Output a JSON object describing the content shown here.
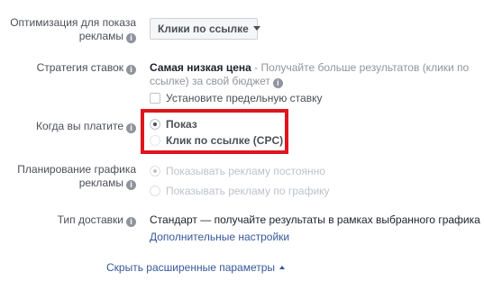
{
  "optimization": {
    "label_line1": "Оптимизация для показа",
    "label_line2": "рекламы",
    "value": "Клики по ссылке"
  },
  "bid_strategy": {
    "label": "Стратегия ставок",
    "value_bold": "Самая низкая цена",
    "desc_line1": " - Получайте больше результатов (клики по",
    "desc_line2": "ссылке) за свой бюджет",
    "cap_checkbox_label": "Установите предельную ставку"
  },
  "payment": {
    "label": "Когда вы платите",
    "options": [
      {
        "label": "Показ",
        "selected": true
      },
      {
        "label": "Клик по ссылке (CPC)",
        "selected": false
      }
    ],
    "highlight_color": "#e0141e"
  },
  "scheduling": {
    "label_line1": "Планирование графика",
    "label_line2": "рекламы",
    "options": [
      {
        "label": "Показывать рекламу постоянно",
        "selected": true,
        "disabled": true
      },
      {
        "label": "Показывать рекламу по графику",
        "selected": false,
        "disabled": true
      }
    ]
  },
  "delivery": {
    "label": "Тип доставки",
    "value": "Стандарт — получайте результаты в рамках выбранного графика",
    "more_link": "Дополнительные настройки"
  },
  "hide_advanced_link": "Скрыть расширенные параметры",
  "icons": {
    "info": "i",
    "dropdown": "chevron-down-icon",
    "collapse": "chevron-up-icon"
  },
  "colors": {
    "link": "#365899",
    "label": "#4b4f56",
    "muted": "#90949c",
    "disabled": "#bec3c9"
  }
}
